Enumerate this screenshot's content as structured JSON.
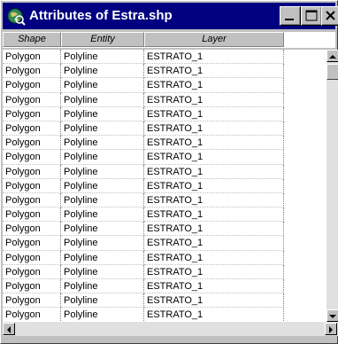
{
  "window": {
    "title": "Attributes of Estra.shp",
    "icon": "globe-icon"
  },
  "controls": {
    "minimize_icon": "minimize-icon",
    "maximize_icon": "maximize-icon",
    "close_icon": "close-icon"
  },
  "columns": [
    "Shape",
    "Entity",
    "Layer"
  ],
  "rows": [
    [
      "Polygon",
      "Polyline",
      "ESTRATO_1"
    ],
    [
      "Polygon",
      "Polyline",
      "ESTRATO_1"
    ],
    [
      "Polygon",
      "Polyline",
      "ESTRATO_1"
    ],
    [
      "Polygon",
      "Polyline",
      "ESTRATO_1"
    ],
    [
      "Polygon",
      "Polyline",
      "ESTRATO_1"
    ],
    [
      "Polygon",
      "Polyline",
      "ESTRATO_1"
    ],
    [
      "Polygon",
      "Polyline",
      "ESTRATO_1"
    ],
    [
      "Polygon",
      "Polyline",
      "ESTRATO_1"
    ],
    [
      "Polygon",
      "Polyline",
      "ESTRATO_1"
    ],
    [
      "Polygon",
      "Polyline",
      "ESTRATO_1"
    ],
    [
      "Polygon",
      "Polyline",
      "ESTRATO_1"
    ],
    [
      "Polygon",
      "Polyline",
      "ESTRATO_1"
    ],
    [
      "Polygon",
      "Polyline",
      "ESTRATO_1"
    ],
    [
      "Polygon",
      "Polyline",
      "ESTRATO_1"
    ],
    [
      "Polygon",
      "Polyline",
      "ESTRATO_1"
    ],
    [
      "Polygon",
      "Polyline",
      "ESTRATO_1"
    ],
    [
      "Polygon",
      "Polyline",
      "ESTRATO_1"
    ],
    [
      "Polygon",
      "Polyline",
      "ESTRATO_1"
    ],
    [
      "Polygon",
      "Polyline",
      "ESTRATO_1"
    ]
  ],
  "colors": {
    "titlebar": "#000080",
    "title_text": "#ffffff",
    "chrome": "#c0c0c0"
  }
}
